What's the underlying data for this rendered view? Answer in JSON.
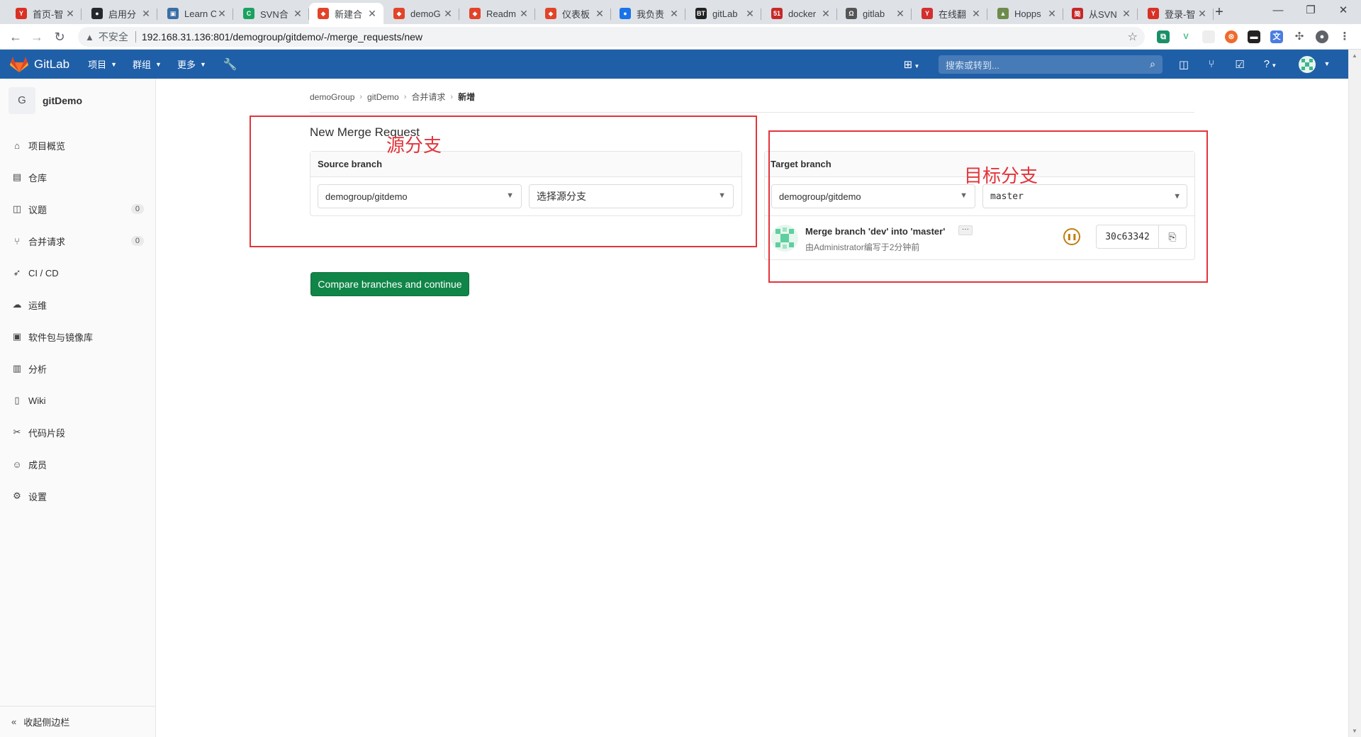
{
  "browser": {
    "tabs": [
      {
        "title": "首页-智",
        "fav_color": "#d93025",
        "fav_glyph": "Y"
      },
      {
        "title": "启用分",
        "fav_color": "#24292e",
        "fav_glyph": "●"
      },
      {
        "title": "Learn C",
        "fav_color": "#3a6ea5",
        "fav_glyph": "▣"
      },
      {
        "title": "SVN合",
        "fav_color": "#1aa260",
        "fav_glyph": "C"
      },
      {
        "title": "新建合",
        "fav_color": "#e24329",
        "fav_glyph": "◆",
        "active": true
      },
      {
        "title": "demoG",
        "fav_color": "#e24329",
        "fav_glyph": "◆"
      },
      {
        "title": "Readm",
        "fav_color": "#e24329",
        "fav_glyph": "◆"
      },
      {
        "title": "仪表板",
        "fav_color": "#e24329",
        "fav_glyph": "◆"
      },
      {
        "title": "我负责",
        "fav_color": "#1a73e8",
        "fav_glyph": "●"
      },
      {
        "title": "gitLab",
        "fav_color": "#222222",
        "fav_glyph": "BT"
      },
      {
        "title": "docker",
        "fav_color": "#c62828",
        "fav_glyph": "51"
      },
      {
        "title": "gitlab",
        "fav_color": "#555555",
        "fav_glyph": "Ω"
      },
      {
        "title": "在线翻",
        "fav_color": "#d32f2f",
        "fav_glyph": "Y"
      },
      {
        "title": "Hopps",
        "fav_color": "#6d8b4a",
        "fav_glyph": "▲"
      },
      {
        "title": "从SVN",
        "fav_color": "#c62828",
        "fav_glyph": "简"
      },
      {
        "title": "登录-智",
        "fav_color": "#d93025",
        "fav_glyph": "Y"
      }
    ],
    "new_tab": "+",
    "window_controls": {
      "minimize": "—",
      "maximize": "❐",
      "close": "✕"
    },
    "insecure_label": "不安全",
    "url": "192.168.31.136:801/demogroup/gitdemo/-/merge_requests/new"
  },
  "header": {
    "brand": "GitLab",
    "menus": [
      "项目",
      "群组",
      "更多"
    ],
    "search_placeholder": "搜索或转到..."
  },
  "sidebar": {
    "project_initial": "G",
    "project_name": "gitDemo",
    "items": [
      {
        "label": "项目概览",
        "icon": "home-icon",
        "glyph": "⌂"
      },
      {
        "label": "仓库",
        "icon": "repository-icon",
        "glyph": "▤"
      },
      {
        "label": "议题",
        "icon": "issues-icon",
        "glyph": "◫",
        "count": "0"
      },
      {
        "label": "合并请求",
        "icon": "merge-request-icon",
        "glyph": "⑂",
        "count": "0"
      },
      {
        "label": "CI / CD",
        "icon": "rocket-icon",
        "glyph": "➶"
      },
      {
        "label": "运维",
        "icon": "cloud-icon",
        "glyph": "☁"
      },
      {
        "label": "软件包与镜像库",
        "icon": "package-icon",
        "glyph": "▣"
      },
      {
        "label": "分析",
        "icon": "chart-icon",
        "glyph": "▥"
      },
      {
        "label": "Wiki",
        "icon": "book-icon",
        "glyph": "▯"
      },
      {
        "label": "代码片段",
        "icon": "scissors-icon",
        "glyph": "✂"
      },
      {
        "label": "成员",
        "icon": "users-icon",
        "glyph": "☺"
      },
      {
        "label": "设置",
        "icon": "gear-icon",
        "glyph": "⚙"
      }
    ],
    "collapse_label": "收起侧边栏"
  },
  "breadcrumb": [
    "demoGroup",
    "gitDemo",
    "合并请求",
    "新增"
  ],
  "page": {
    "title": "New Merge Request",
    "source": {
      "heading": "Source branch",
      "project": "demogroup/gitdemo",
      "branch_placeholder": "选择源分支"
    },
    "target": {
      "heading": "Target branch",
      "project": "demogroup/gitdemo",
      "branch": "master",
      "commit": {
        "title": "Merge branch 'dev' into 'master'",
        "more": "···",
        "subtitle": "由Administrator编写于2分钟前",
        "sha": "30c63342",
        "pipeline_status": "paused"
      }
    },
    "compare_button": "Compare branches and continue"
  },
  "annotations": {
    "source_label": "源分支",
    "target_label": "目标分支",
    "color": "#e3343b"
  }
}
